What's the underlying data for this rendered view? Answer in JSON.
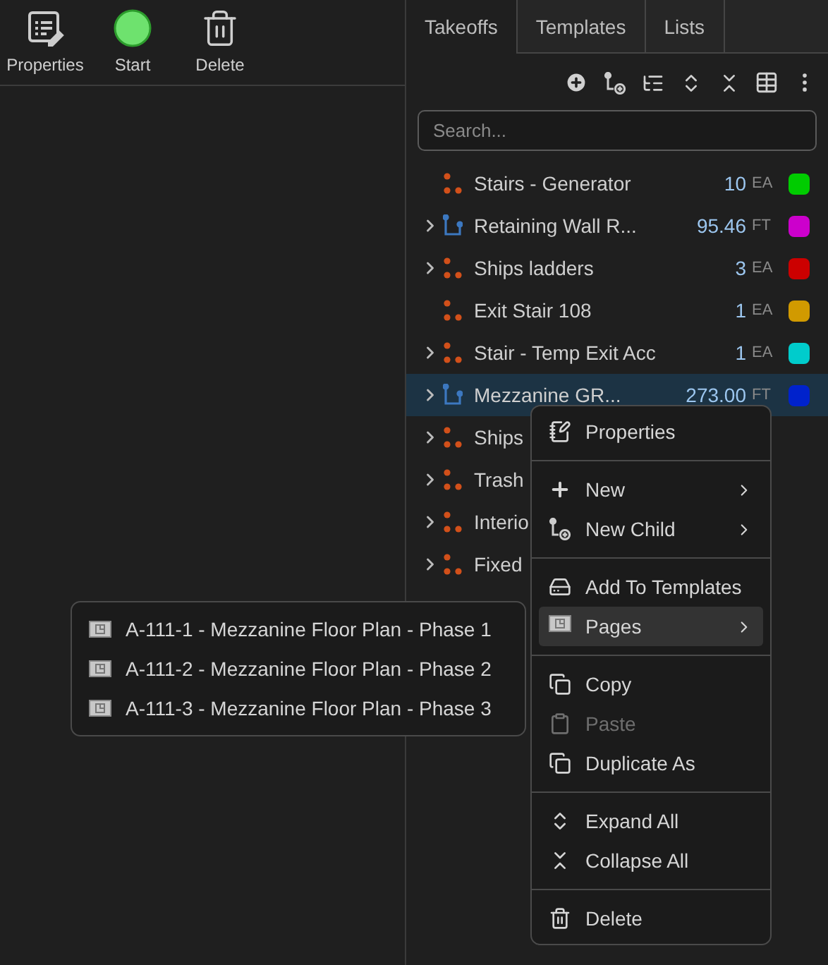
{
  "toolbar": [
    {
      "kind": "properties",
      "label": "Properties"
    },
    {
      "kind": "start",
      "label": "Start"
    },
    {
      "kind": "delete",
      "label": "Delete"
    }
  ],
  "tabs": [
    {
      "label": "Takeoffs",
      "selected": true
    },
    {
      "label": "Templates",
      "selected": false
    },
    {
      "label": "Lists",
      "selected": false
    }
  ],
  "search": {
    "placeholder": "Search..."
  },
  "rows": [
    {
      "kind": "count",
      "name": "Stairs - Generator",
      "quantity": "10",
      "unit": "EA",
      "color": "#00cc00",
      "has_children": false,
      "selected": false
    },
    {
      "kind": "linear",
      "name": "Retaining Wall R...",
      "quantity": "95.46",
      "unit": "FT",
      "color": "#cc00cc",
      "has_children": true,
      "selected": false
    },
    {
      "kind": "count",
      "name": "Ships ladders",
      "quantity": "3",
      "unit": "EA",
      "color": "#cc0000",
      "has_children": true,
      "selected": false
    },
    {
      "kind": "count",
      "name": "Exit Stair 108",
      "quantity": "1",
      "unit": "EA",
      "color": "#d19a00",
      "has_children": false,
      "selected": false
    },
    {
      "kind": "count",
      "name": "Stair - Temp Exit Acc",
      "quantity": "1",
      "unit": "EA",
      "color": "#00cccc",
      "has_children": true,
      "selected": false
    },
    {
      "kind": "linear",
      "name": "Mezzanine GR...",
      "quantity": "273.00",
      "unit": "FT",
      "color": "#0022cc",
      "has_children": true,
      "selected": true
    },
    {
      "kind": "count",
      "name": "Ships",
      "has_children": true,
      "selected": false
    },
    {
      "kind": "count",
      "name": "Trash",
      "has_children": true,
      "selected": false
    },
    {
      "kind": "count",
      "name": "Interio",
      "has_children": true,
      "selected": false
    },
    {
      "kind": "count",
      "name": "Fixed",
      "has_children": true,
      "selected": false
    }
  ],
  "context_menu": [
    {
      "kind": "properties",
      "label": "Properties",
      "submenu": false,
      "disabled": false,
      "selected": false
    },
    {
      "kind": "separator"
    },
    {
      "kind": "plus",
      "label": "New",
      "submenu": true,
      "disabled": false,
      "selected": false
    },
    {
      "kind": "child",
      "label": "New Child",
      "submenu": true,
      "disabled": false,
      "selected": false
    },
    {
      "kind": "separator"
    },
    {
      "kind": "template",
      "label": "Add To Templates",
      "submenu": false,
      "disabled": false,
      "selected": false
    },
    {
      "kind": "page",
      "label": "Pages",
      "submenu": true,
      "disabled": false,
      "selected": true
    },
    {
      "kind": "separator"
    },
    {
      "kind": "copy",
      "label": "Copy",
      "submenu": false,
      "disabled": false,
      "selected": false
    },
    {
      "kind": "clipboard",
      "label": "Paste",
      "submenu": false,
      "disabled": true,
      "selected": false
    },
    {
      "kind": "copy",
      "label": "Duplicate As",
      "submenu": false,
      "disabled": false,
      "selected": false
    },
    {
      "kind": "separator"
    },
    {
      "kind": "expand",
      "label": "Expand All",
      "submenu": false,
      "disabled": false,
      "selected": false
    },
    {
      "kind": "collapse",
      "label": "Collapse All",
      "submenu": false,
      "disabled": false,
      "selected": false
    },
    {
      "kind": "separator"
    },
    {
      "kind": "trash",
      "label": "Delete",
      "submenu": false,
      "disabled": false,
      "selected": false
    }
  ],
  "pages_submenu": [
    "A-111-1 - Mezzanine Floor Plan - Phase 1",
    "A-111-2 - Mezzanine Floor Plan - Phase 2",
    "A-111-3 - Mezzanine Floor Plan - Phase 3"
  ]
}
